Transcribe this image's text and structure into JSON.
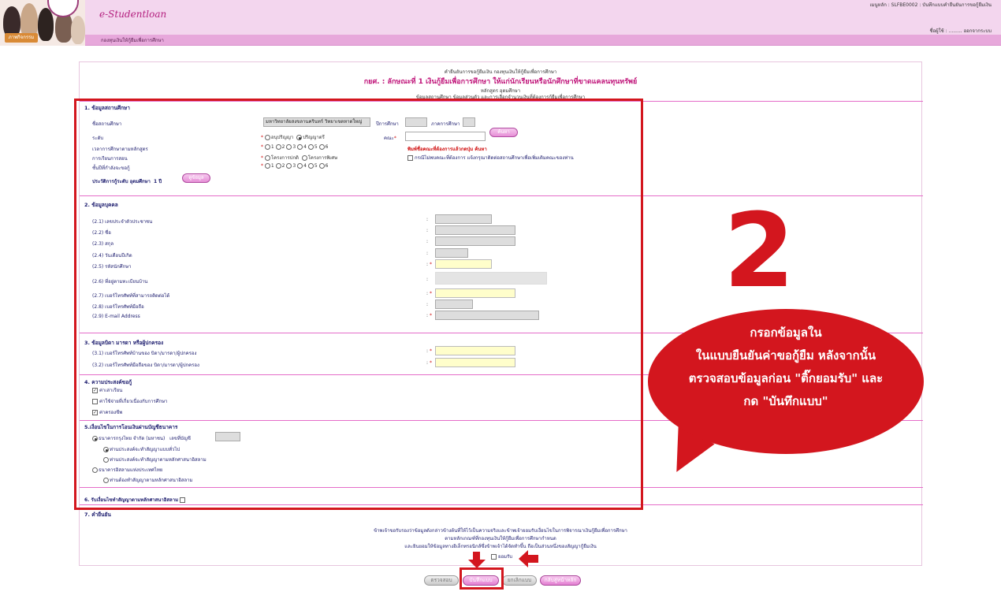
{
  "header": {
    "brand": "e-Studentloan",
    "subtitle": "กองทุนเงินให้กู้ยืมเพื่อการศึกษา",
    "badge": "ภาพกิจกรรม",
    "right_top": "เมนูหลัก : SLFBE0002 : บันทึกแบบคำยืนยันการขอกู้ยืมเงิน",
    "right_bottom": "ชื่อผู้ใช้ : ......... ออกจากระบบ"
  },
  "form_header": {
    "line1": "คำยืนยันการขอกู้ยืมเงิน กองทุนเงินให้กู้ยืมเพื่อการศึกษา",
    "line2": "กยศ. : ลักษณะที่ 1 เงินกู้ยืมเพื่อการศึกษา ให้แก่นักเรียนหรือนักศึกษาที่ขาดแคลนทุนทรัพย์",
    "line3": "หลักสูตร อุดมศึกษา",
    "line4": "ข้อมูลสถานศึกษา ข้อมูลส่วนตัว และการเลือกจำนวนเงินที่ต้องการกู้ยืมเพื่อการศึกษา"
  },
  "s1": {
    "title": "1. ข้อมูลสถานศึกษา",
    "school_label": "ชื่อสถานศึกษา",
    "school_value": "มหาวิทยาลัยสงขลานครินทร์ วิทยาเขตหาดใหญ่",
    "year_label": "ปีการศึกษา",
    "term_label": "ภาคการศึกษา",
    "level_label": "ระดับ",
    "level_opt1": "อนุปริญญา",
    "level_opt2": "ปริญญาตรี",
    "faculty_label": "คณะ",
    "search_btn": "ค้นหา",
    "duration_label": "เวลาการศึกษาตามหลักสูตร",
    "opts": [
      "1",
      "2",
      "3",
      "4",
      "5",
      "6"
    ],
    "faculty_hint": "พิมพ์ชื่อคณะที่ต้องการแล้วกดปุ่ม ค้นหา",
    "program_label": "การเรียนการสอน",
    "program_opt1": "โครงการปกติ",
    "program_opt2": "โครงการพิเศษ",
    "program_note": "กรณีไม่พบคณะที่ต้องการ แจ้งกรุณาติดต่อสถานศึกษาเพื่อเพิ่มเติมคณะของท่าน",
    "grade_label": "ชั้นปีที่กำลังจะขอกู้",
    "history_label": "ประวัติการกู้ระดับ อุดมศึกษา",
    "history_value": "1",
    "history_unit": "ปี",
    "history_btn": "ดูข้อมูล"
  },
  "s2": {
    "title": "2. ข้อมูลบุคคล",
    "items": [
      "(2.1) เลขประจำตัวประชาชน",
      "(2.2) ชื่อ",
      "(2.3) สกุล",
      "(2.4) วันเดือนปีเกิด",
      "(2.5) รหัสนักศึกษา",
      "(2.6) ที่อยู่ตามทะเบียนบ้าน",
      "(2.7) เบอร์โทรศัพท์ที่สามารถติดต่อได้",
      "(2.8) เบอร์โทรศัพท์มือถือ",
      "(2.9) E-mail Address"
    ]
  },
  "s3": {
    "title": "3. ข้อมูลบิดา มารดา หรือผู้ปกครอง",
    "items": [
      "(3.1) เบอร์โทรศัพท์บ้านของ บิดา/มารดา/ผู้ปกครอง",
      "(3.2) เบอร์โทรศัพท์มือถือของ บิดา/มารดา/ผู้ปกครอง"
    ]
  },
  "s4": {
    "title": "4. ความประสงค์ขอกู้",
    "items": [
      {
        "label": "ค่าเล่าเรียน",
        "checked": true
      },
      {
        "label": "ค่าใช้จ่ายที่เกี่ยวเนื่องกับการศึกษา",
        "checked": false
      },
      {
        "label": "ค่าครองชีพ",
        "checked": true
      }
    ]
  },
  "s5": {
    "title": "5.เงื่อนไขในการโอนเงินผ่านบัญชีธนาคาร",
    "bank1": "ธนาคารกรุงไทย จำกัด (มหาชน)",
    "account_label": "เลขที่บัญชี",
    "bank1_opt1": "ท่านประสงค์จะทำสัญญาแบบทั่วไป",
    "bank1_opt2": "ท่านประสงค์จะทำสัญญาตามหลักศาสนาอิสลาม",
    "bank2": "ธนาคารอิสลามแห่งประเทศไทย",
    "bank2_opt1": "ท่านต้องทำสัญญาตามหลักศาสนาอิสลาม"
  },
  "s6": {
    "title": "6. รับเงื่อนไขทำสัญญาตามหลักศาสนาอิสลาม"
  },
  "s7": {
    "title": "7. คำยืนยัน",
    "line1": "ข้าพเจ้าขอรับรองว่าข้อมูลดังกล่าวข้างต้นที่ให้ไว้เป็นความจริงและข้าพเจ้ายอมรับเงื่อนไขในการพิจารณาเงินกู้ยืมเพื่อการศึกษา",
    "line2": "ตามหลักเกณฑ์ที่กองทุนเงินให้กู้ยืมเพื่อการศึกษากำหนด",
    "line3": "และยินยอมให้ข้อมูลทางอิเล็กทรอนิกส์ซึ่งข้าพเจ้าได้จัดทำขึ้น ถือเป็นส่วนหนึ่งของสัญญากู้ยืมเงิน",
    "accept_label": "ยอมรับ"
  },
  "buttons": {
    "check": "ตรวจสอบ",
    "save": "บันทึกแบบ",
    "cancel": "ยกเลิกแบบ",
    "back": "กลับสู่หน้าหลัก"
  },
  "annotation": {
    "step": "2",
    "line1": "กรอกข้อมูลใน",
    "line2": "ในแบบยืนยันค่าขอกู้ยืม หลังจากนั้น",
    "line3": "ตรวจสอบข้อมูลก่อน \"ติ๊กยอมรับ\" และ",
    "line4": "กด \"บันทึกแบบ\""
  },
  "colors": {
    "accent": "#e7a8db",
    "title": "#c0157a",
    "annotation": "#d3161e"
  }
}
